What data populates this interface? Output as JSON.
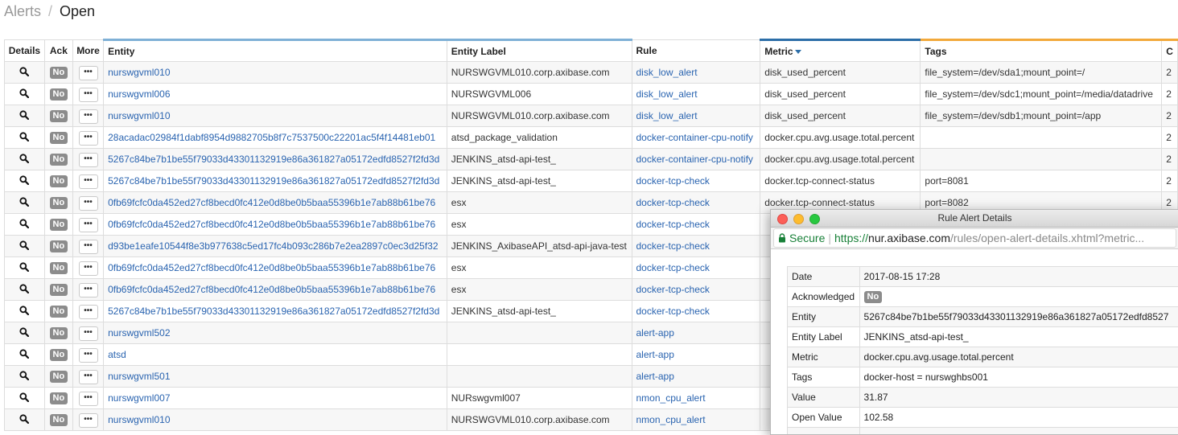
{
  "breadcrumb": {
    "root": "Alerts",
    "separator": "/",
    "current": "Open"
  },
  "table": {
    "columns": {
      "details": "Details",
      "ack": "Ack",
      "more": "More",
      "entity": "Entity",
      "entity_label": "Entity Label",
      "rule": "Rule",
      "metric": "Metric",
      "tags": "Tags",
      "overflow": "C"
    },
    "sorted_column": "Metric",
    "ack_label": "No",
    "more_label": "•••",
    "rows": [
      {
        "entity": "nurswgvml010",
        "entity_label": "NURSWGVML010.corp.axibase.com",
        "rule": "disk_low_alert",
        "metric": "disk_used_percent",
        "tags": "file_system=/dev/sda1;mount_point=/",
        "more": "2"
      },
      {
        "entity": "nurswgvml006",
        "entity_label": "NURSWGVML006",
        "rule": "disk_low_alert",
        "metric": "disk_used_percent",
        "tags": "file_system=/dev/sdc1;mount_point=/media/datadrive",
        "more": "2"
      },
      {
        "entity": "nurswgvml010",
        "entity_label": "NURSWGVML010.corp.axibase.com",
        "rule": "disk_low_alert",
        "metric": "disk_used_percent",
        "tags": "file_system=/dev/sdb1;mount_point=/app",
        "more": "2"
      },
      {
        "entity": "28acadac02984f1dabf8954d9882705b8f7c7537500c22201ac5f4f14481eb01",
        "entity_label": "atsd_package_validation",
        "rule": "docker-container-cpu-notify",
        "metric": "docker.cpu.avg.usage.total.percent",
        "tags": "",
        "more": "2"
      },
      {
        "entity": "5267c84be7b1be55f79033d43301132919e86a361827a05172edfd8527f2fd3d",
        "entity_label": "JENKINS_atsd-api-test_",
        "rule": "docker-container-cpu-notify",
        "metric": "docker.cpu.avg.usage.total.percent",
        "tags": "",
        "more": "2"
      },
      {
        "entity": "5267c84be7b1be55f79033d43301132919e86a361827a05172edfd8527f2fd3d",
        "entity_label": "JENKINS_atsd-api-test_",
        "rule": "docker-tcp-check",
        "metric": "docker.tcp-connect-status",
        "tags": "port=8081",
        "more": "2"
      },
      {
        "entity": "0fb69fcfc0da452ed27cf8becd0fc412e0d8be0b5baa55396b1e7ab88b61be76",
        "entity_label": "esx",
        "rule": "docker-tcp-check",
        "metric": "docker.tcp-connect-status",
        "tags": "port=8082",
        "more": "2"
      },
      {
        "entity": "0fb69fcfc0da452ed27cf8becd0fc412e0d8be0b5baa55396b1e7ab88b61be76",
        "entity_label": "esx",
        "rule": "docker-tcp-check",
        "metric": "",
        "tags": "",
        "more": ""
      },
      {
        "entity": "d93be1eafe10544f8e3b977638c5ed17fc4b093c286b7e2ea2897c0ec3d25f32",
        "entity_label": "JENKINS_AxibaseAPI_atsd-api-java-test",
        "rule": "docker-tcp-check",
        "metric": "",
        "tags": "",
        "more": ""
      },
      {
        "entity": "0fb69fcfc0da452ed27cf8becd0fc412e0d8be0b5baa55396b1e7ab88b61be76",
        "entity_label": "esx",
        "rule": "docker-tcp-check",
        "metric": "",
        "tags": "",
        "more": ""
      },
      {
        "entity": "0fb69fcfc0da452ed27cf8becd0fc412e0d8be0b5baa55396b1e7ab88b61be76",
        "entity_label": "esx",
        "rule": "docker-tcp-check",
        "metric": "",
        "tags": "",
        "more": ""
      },
      {
        "entity": "5267c84be7b1be55f79033d43301132919e86a361827a05172edfd8527f2fd3d",
        "entity_label": "JENKINS_atsd-api-test_",
        "rule": "docker-tcp-check",
        "metric": "",
        "tags": "",
        "more": ""
      },
      {
        "entity": "nurswgvml502",
        "entity_label": "",
        "rule": "alert-app",
        "metric": "",
        "tags": "",
        "more": ""
      },
      {
        "entity": "atsd",
        "entity_label": "",
        "rule": "alert-app",
        "metric": "",
        "tags": "",
        "more": ""
      },
      {
        "entity": "nurswgvml501",
        "entity_label": "",
        "rule": "alert-app",
        "metric": "",
        "tags": "",
        "more": ""
      },
      {
        "entity": "nurswgvml007",
        "entity_label": "NURswgvml007",
        "rule": "nmon_cpu_alert",
        "metric": "",
        "tags": "",
        "more": ""
      },
      {
        "entity": "nurswgvml010",
        "entity_label": "NURSWGVML010.corp.axibase.com",
        "rule": "nmon_cpu_alert",
        "metric": "",
        "tags": "",
        "more": ""
      }
    ]
  },
  "popup": {
    "title": "Rule Alert Details",
    "secure_label": "Secure",
    "url_separator": "|",
    "url_scheme": "https://",
    "url_host": "nur.axibase.com",
    "url_path": "/rules/open-alert-details.xhtml?metric...",
    "details": [
      {
        "key": "Date",
        "value": "2017-08-15 17:28"
      },
      {
        "key": "Acknowledged",
        "value": "No",
        "badge": true
      },
      {
        "key": "Entity",
        "value": "5267c84be7b1be55f79033d43301132919e86a361827a05172edfd8527"
      },
      {
        "key": "Entity Label",
        "value": "JENKINS_atsd-api-test_"
      },
      {
        "key": "Metric",
        "value": "docker.cpu.avg.usage.total.percent"
      },
      {
        "key": "Tags",
        "value": "docker-host = nurswghbs001"
      },
      {
        "key": "Value",
        "value": "31.87"
      },
      {
        "key": "Open Value",
        "value": "102.58"
      },
      {
        "key": "",
        "value": ""
      }
    ]
  },
  "colors": {
    "link": "#2a64b0",
    "badge": "#8c8c8c",
    "accent_blue": "#2c6ea8",
    "accent_light_blue": "#7fb0d6",
    "accent_orange": "#f2a93b",
    "secure_green": "#188038"
  },
  "icons": {
    "details": "magnifier-icon",
    "lock": "lock-icon"
  }
}
